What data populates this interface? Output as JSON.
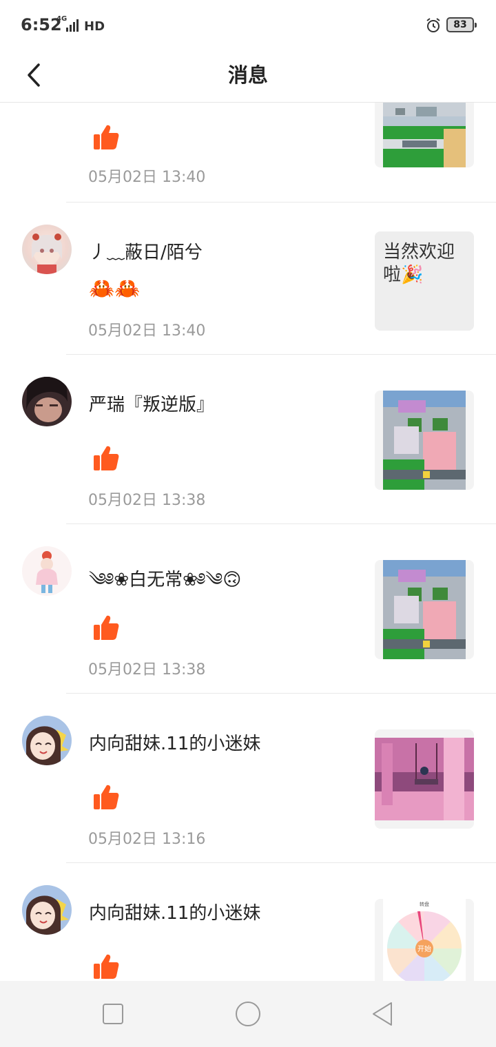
{
  "status_bar": {
    "time": "6:52",
    "network": "4G",
    "hd": "HD",
    "battery": "83",
    "icons": [
      "signal-icon",
      "alarm-icon",
      "battery-icon"
    ]
  },
  "header": {
    "title": "消息",
    "back_icon": "chevron-left-icon"
  },
  "messages": [
    {
      "name": "",
      "content_type": "like",
      "time": "05月02日 13:40",
      "thumbnail": "game-screenshot"
    },
    {
      "name": "丿﹏蔽日/陌兮",
      "content_type": "text",
      "content": "🦀🦀",
      "time": "05月02日 13:40",
      "thumbnail_text": "当然欢迎啦🎉"
    },
    {
      "name": "严瑞『叛逆版』",
      "content_type": "like",
      "time": "05月02日 13:38",
      "thumbnail": "game-screenshot"
    },
    {
      "name": "༄༅❀白无常❀༅༄🙃",
      "content_type": "like",
      "time": "05月02日 13:38",
      "thumbnail": "game-screenshot"
    },
    {
      "name": "内向甜妹.11的小迷妹",
      "content_type": "like",
      "time": "05月02日 13:16",
      "thumbnail": "cherry-blossom-image"
    },
    {
      "name": "内向甜妹.11的小迷妹",
      "content_type": "like",
      "time": "",
      "thumbnail": "spin-wheel-image",
      "thumbnail_title": "转盘",
      "wheel_center": "开始"
    }
  ],
  "nav_bar": {
    "icons": [
      "recent-apps-icon",
      "home-icon",
      "back-icon"
    ]
  },
  "colors": {
    "like": "#ff5a1f",
    "time": "#9a9a9a",
    "divider": "#e8e8e8"
  }
}
